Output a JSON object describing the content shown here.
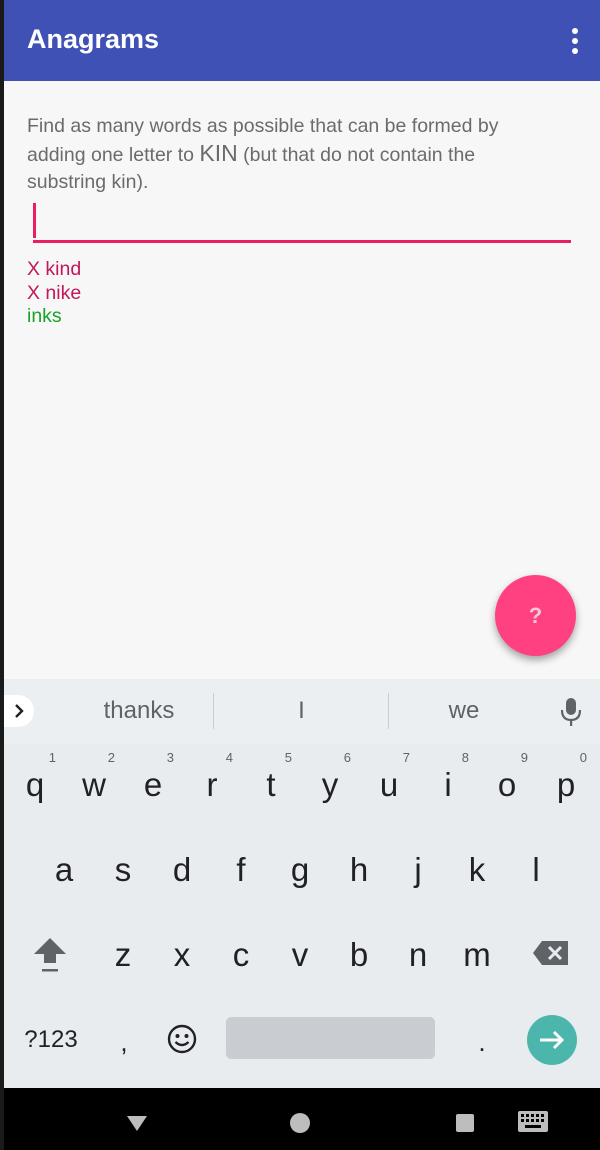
{
  "appbar": {
    "title": "Anagrams",
    "overflow_icon": "more-vert-icon"
  },
  "game": {
    "instruction_prefix": "Find as many words as possible that can be formed by adding one letter to ",
    "starter_word": "KIN",
    "instruction_suffix": " (but that do not contain the substring kin).",
    "input_value": "",
    "results": [
      {
        "text": "X kind",
        "status": "wrong"
      },
      {
        "text": "X nike",
        "status": "wrong"
      },
      {
        "text": "inks",
        "status": "correct"
      }
    ],
    "fab_label": "?"
  },
  "keyboard": {
    "suggestions": [
      "thanks",
      "I",
      "we"
    ],
    "row1": [
      {
        "ch": "q",
        "num": "1"
      },
      {
        "ch": "w",
        "num": "2"
      },
      {
        "ch": "e",
        "num": "3"
      },
      {
        "ch": "r",
        "num": "4"
      },
      {
        "ch": "t",
        "num": "5"
      },
      {
        "ch": "y",
        "num": "6"
      },
      {
        "ch": "u",
        "num": "7"
      },
      {
        "ch": "i",
        "num": "8"
      },
      {
        "ch": "o",
        "num": "9"
      },
      {
        "ch": "p",
        "num": "0"
      }
    ],
    "row2": [
      "a",
      "s",
      "d",
      "f",
      "g",
      "h",
      "j",
      "k",
      "l"
    ],
    "row3": [
      "z",
      "x",
      "c",
      "v",
      "b",
      "n",
      "m"
    ],
    "symbols_label": "?123",
    "comma_label": ",",
    "period_label": "."
  },
  "colors": {
    "appbar": "#3f51b5",
    "accent": "#e91e63",
    "fab": "#ff4081",
    "wrong": "#c2185b",
    "correct": "#1aa32a",
    "enter": "#4db6ac"
  }
}
